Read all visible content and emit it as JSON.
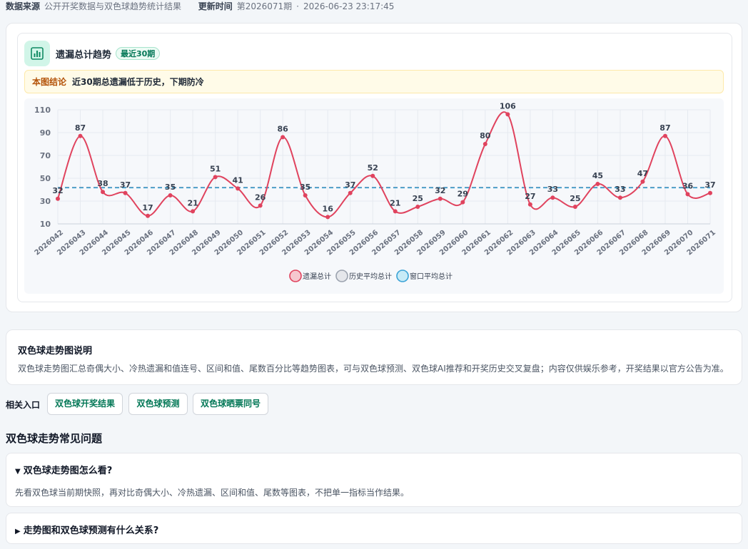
{
  "meta": {
    "source_label": "数据来源",
    "source_value": "公开开奖数据与双色球趋势统计结果",
    "update_label": "更新时间",
    "issue": "第2026071期",
    "sep": "·",
    "time": "2026-06-23 23:17:45"
  },
  "card": {
    "icon": "bar-chart-icon",
    "title": "遗漏总计趋势",
    "badge": "最近30期",
    "conclusion_label": "本图结论",
    "conclusion_text": "近30期总遗漏低于历史，下期防冷"
  },
  "chart_data": {
    "type": "line",
    "x": [
      "2026042",
      "2026043",
      "2026044",
      "2026045",
      "2026046",
      "2026047",
      "2026048",
      "2026049",
      "2026050",
      "2026051",
      "2026052",
      "2026053",
      "2026054",
      "2026055",
      "2026056",
      "2026057",
      "2026058",
      "2026059",
      "2026060",
      "2026061",
      "2026062",
      "2026063",
      "2026064",
      "2026065",
      "2026066",
      "2026067",
      "2026068",
      "2026069",
      "2026070",
      "2026071"
    ],
    "series": [
      {
        "name": "遗漏总计",
        "color": "#e0435e",
        "values": [
          32,
          87,
          38,
          37,
          17,
          35,
          21,
          51,
          41,
          26,
          86,
          35,
          16,
          37,
          52,
          21,
          25,
          32,
          29,
          80,
          106,
          27,
          33,
          25,
          45,
          33,
          47,
          87,
          36,
          37
        ]
      },
      {
        "name": "历史平均总计",
        "color": "#9ca3af",
        "values": [
          42,
          42,
          42,
          42,
          42,
          42,
          42,
          42,
          42,
          42,
          42,
          42,
          42,
          42,
          42,
          42,
          42,
          42,
          42,
          42,
          42,
          42,
          42,
          42,
          42,
          42,
          42,
          42,
          42,
          42
        ]
      },
      {
        "name": "窗口平均总计",
        "color": "#3ba3d6",
        "values": [
          42,
          42,
          42,
          42,
          42,
          42,
          42,
          42,
          42,
          42,
          42,
          42,
          42,
          42,
          42,
          42,
          42,
          42,
          42,
          42,
          42,
          42,
          42,
          42,
          42,
          42,
          42,
          42,
          42,
          42
        ]
      }
    ],
    "yticks": [
      110,
      90,
      70,
      50,
      30,
      10
    ],
    "ylim": [
      10,
      110
    ],
    "grid": true,
    "legend": "bottom"
  },
  "desc": {
    "title": "双色球走势图说明",
    "text": "双色球走势图汇总奇偶大小、冷热遗漏和值连号、区间和值、尾数百分比等趋势图表，可与双色球预测、双色球AI推荐和开奖历史交叉复盘；内容仅供娱乐参考，开奖结果以官方公告为准。"
  },
  "related": {
    "label": "相关入口",
    "links": [
      "双色球开奖结果",
      "双色球预测",
      "双色球晒票同号"
    ]
  },
  "faq": {
    "heading": "双色球走势常见问题",
    "items": [
      {
        "marker": "▼",
        "q": "双色球走势图怎么看?",
        "a": "先看双色球当前期快照，再对比奇偶大小、冷热遗漏、区间和值、尾数等图表，不把单一指标当作结果。"
      },
      {
        "marker": "▶",
        "q": "走势图和双色球预测有什么关系?",
        "a": ""
      }
    ]
  }
}
